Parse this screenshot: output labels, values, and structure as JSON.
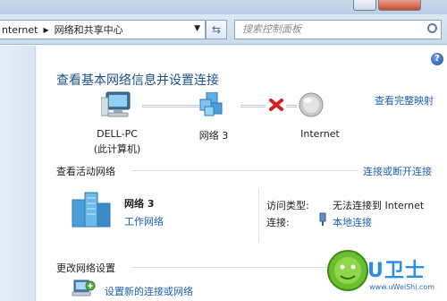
{
  "address_bar": {
    "path_start": "nternet",
    "path_current": "网络和共享中心",
    "search_placeholder": "搜索控制面板"
  },
  "page": {
    "heading": "查看基本网络信息并设置连接",
    "full_map_link": "查看完整映射"
  },
  "network_map": {
    "computer": {
      "name": "DELL-PC",
      "sub": "(此计算机)"
    },
    "network": {
      "name": "网络  3"
    },
    "internet": {
      "name": "Internet"
    }
  },
  "active_networks": {
    "title": "查看活动网络",
    "connect_link": "连接或断开连接",
    "network_name": "网络  3",
    "network_type": "工作网络",
    "access_type_label": "访问类型:",
    "access_type_value": "无法连接到 Internet",
    "connections_label": "连接:",
    "connections_value": "本地连接"
  },
  "change_settings": {
    "title": "更改网络设置",
    "setup_link": "设置新的连接或网络"
  },
  "watermark": {
    "brand": "U卫士",
    "url": "www.uWeiShi.com"
  }
}
